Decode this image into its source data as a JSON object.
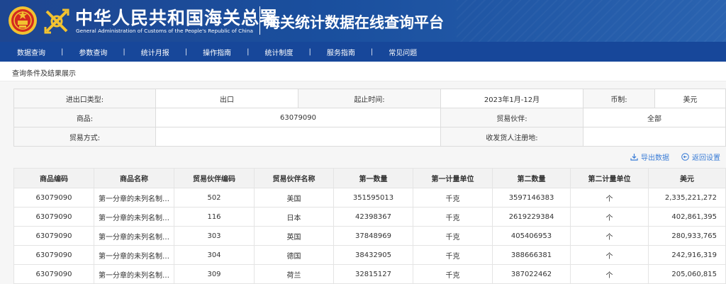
{
  "header": {
    "org_title": "中华人民共和国海关总署",
    "org_subtitle": "General Administration of Customs of the People's Republic of China",
    "platform_title": "海关统计数据在线查询平台"
  },
  "nav": {
    "items": [
      "数据查询",
      "参数查询",
      "统计月报",
      "操作指南",
      "统计制度",
      "服务指南",
      "常见问题"
    ],
    "separator": "|"
  },
  "section": {
    "title": "查询条件及结果展示"
  },
  "conditions": {
    "trade_type_label": "进出口类型:",
    "trade_type_value": "出口",
    "period_label": "起止时间:",
    "period_value": "2023年1月-12月",
    "currency_label": "币制:",
    "currency_value": "美元",
    "product_label": "商品:",
    "product_value": "63079090",
    "partner_label": "贸易伙伴:",
    "partner_value": "全部",
    "mode_label": "贸易方式:",
    "mode_value": "",
    "registration_label": "收发货人注册地:",
    "registration_value": ""
  },
  "actions": {
    "export_label": "导出数据",
    "back_label": "返回设置"
  },
  "table": {
    "columns": [
      "商品编码",
      "商品名称",
      "贸易伙伴编码",
      "贸易伙伴名称",
      "第一数量",
      "第一计量单位",
      "第二数量",
      "第二计量单位",
      "美元"
    ],
    "rows": [
      [
        "63079090",
        "第一分章的未列名制成...",
        "502",
        "美国",
        "351595013",
        "千克",
        "3597146383",
        "个",
        "2,335,221,272"
      ],
      [
        "63079090",
        "第一分章的未列名制成...",
        "116",
        "日本",
        "42398367",
        "千克",
        "2619229384",
        "个",
        "402,861,395"
      ],
      [
        "63079090",
        "第一分章的未列名制成...",
        "303",
        "英国",
        "37848969",
        "千克",
        "405406953",
        "个",
        "280,933,765"
      ],
      [
        "63079090",
        "第一分章的未列名制成...",
        "304",
        "德国",
        "38432905",
        "千克",
        "388666381",
        "个",
        "242,916,319"
      ],
      [
        "63079090",
        "第一分章的未列名制成...",
        "309",
        "荷兰",
        "32815127",
        "千克",
        "387022462",
        "个",
        "205,060,815"
      ]
    ]
  },
  "colors": {
    "header_bg": "#1e4691",
    "nav_bg": "#17479a",
    "link": "#3a7cd6",
    "emblem_red": "#d42a20",
    "emblem_gold": "#f2c230"
  },
  "icons": {
    "emblem": "national-emblem-icon",
    "badge": "customs-badge-icon",
    "export": "download-icon",
    "back": "back-arrow-icon"
  }
}
